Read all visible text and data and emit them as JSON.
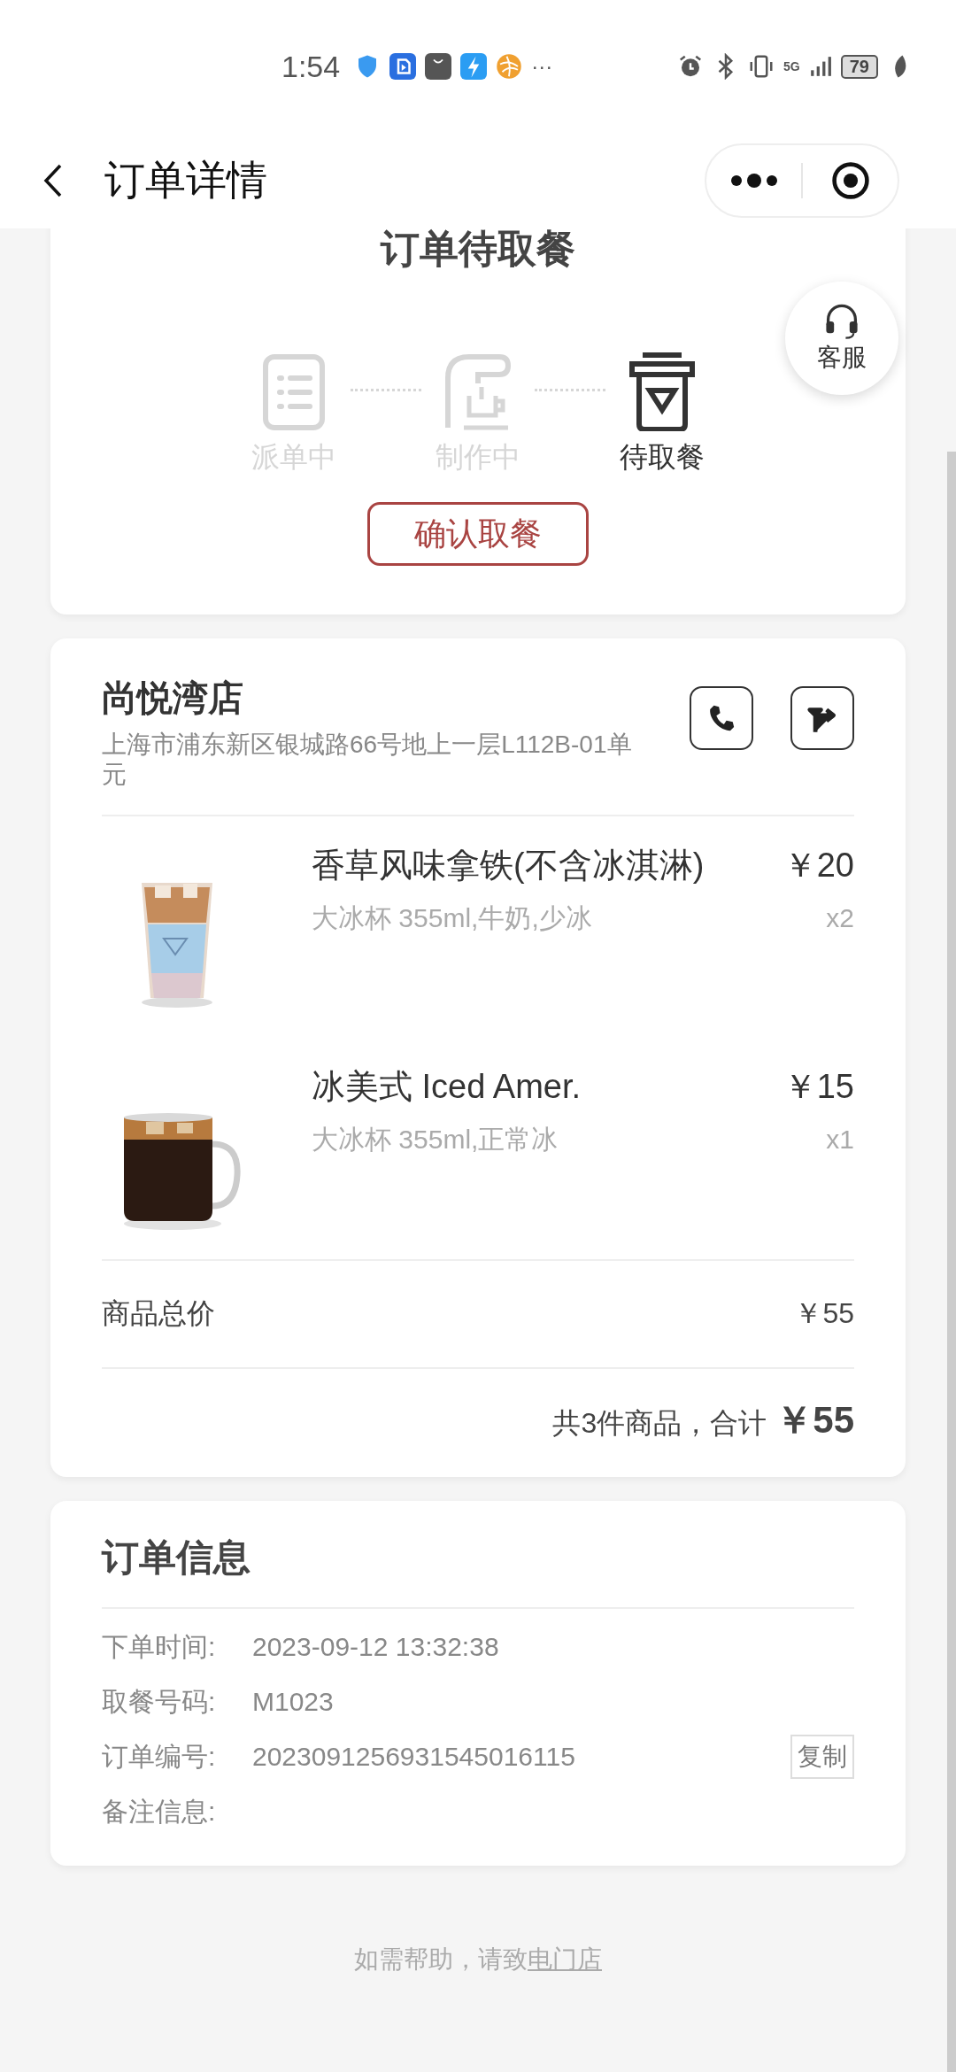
{
  "status_bar": {
    "time": "1:54",
    "more": "···",
    "network": "5G",
    "battery": "79"
  },
  "header": {
    "title": "订单详情"
  },
  "order_status": {
    "title": "订单待取餐",
    "steps": [
      {
        "kind": "dispatch",
        "label": "派单中",
        "active": false
      },
      {
        "kind": "making",
        "label": "制作中",
        "active": false
      },
      {
        "kind": "pickup",
        "label": "待取餐",
        "active": true
      }
    ],
    "confirm_button": "确认取餐"
  },
  "service_button": {
    "label": "客服"
  },
  "store": {
    "name": "尚悦湾店",
    "address": "上海市浦东新区银城路66号地上一层L112B-01单元",
    "items": [
      {
        "kind": "picture",
        "name": "香草风味拿铁(不含冰淇淋)",
        "options": "大冰杯 355ml,牛奶,少冰",
        "price": "￥20",
        "quantity": "x2"
      },
      {
        "kind": "picture",
        "name": "冰美式 Iced Amer.",
        "options": "大冰杯 355ml,正常冰",
        "price": "￥15",
        "quantity": "x1"
      }
    ],
    "subtotal_label": "商品总价",
    "subtotal": "￥55",
    "summary": "共3件商品，合计",
    "total": "￥55"
  },
  "order_info": {
    "title": "订单信息",
    "rows": [
      {
        "label": "下单时间:",
        "value": "2023-09-12 13:32:38"
      },
      {
        "label": "取餐号码:",
        "value": "M1023"
      },
      {
        "label": "订单编号:",
        "value": "2023091256931545016115",
        "action": "复制"
      },
      {
        "label": "备注信息:"
      }
    ]
  },
  "footer": {
    "text": "如需帮助，请致",
    "link": "电门店"
  }
}
